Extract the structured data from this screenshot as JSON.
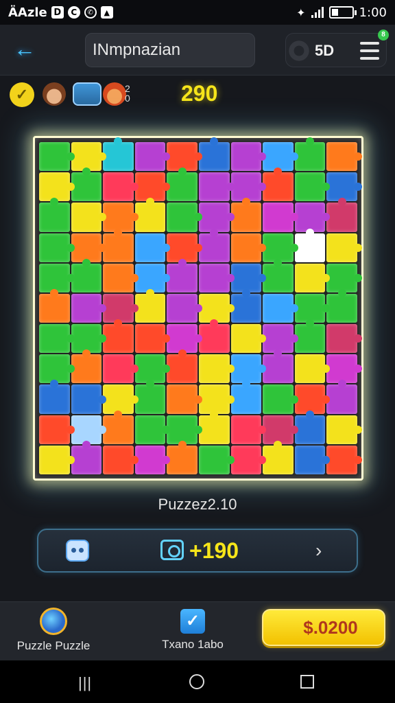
{
  "status_bar": {
    "left_text": "ÄAzle",
    "icons": [
      "notification-d-icon",
      "notification-c-icon",
      "wifi-calling-icon",
      "image-icon"
    ],
    "time": "1:00"
  },
  "header": {
    "title": "INmpnazian",
    "coins": "5D",
    "notification_count": "8"
  },
  "players": {
    "label_top": "2",
    "label_bottom": "0"
  },
  "score": "290",
  "board": {
    "columns": 10,
    "rows": 11,
    "pieces": [
      "#2fc43a",
      "#f3e21c",
      "#25c6d6",
      "#b640d2",
      "#ff4a2a",
      "#2a73d8",
      "#b640d2",
      "#3aa6ff",
      "#2fc43a",
      "#ff7a1c",
      "#f3e21c",
      "#2fc43a",
      "#ff3a5a",
      "#ff4a2a",
      "#2fc43a",
      "#b640d2",
      "#b640d2",
      "#ff4a2a",
      "#2fc43a",
      "#2a73d8",
      "#2fc43a",
      "#f3e21c",
      "#ff7a1c",
      "#f3e21c",
      "#2fc43a",
      "#b640d2",
      "#ff7a1c",
      "#d13ad0",
      "#b640d2",
      "#d13a6a",
      "#2fc43a",
      "#ff7a1c",
      "#ff7a1c",
      "#3aa6ff",
      "#ff4a2a",
      "#b640d2",
      "#ff7a1c",
      "#2fc43a",
      "#ffffff",
      "#f3e21c",
      "#2fc43a",
      "#2fc43a",
      "#ff7a1c",
      "#3aa6ff",
      "#b640d2",
      "#b640d2",
      "#2a73d8",
      "#2fc43a",
      "#f3e21c",
      "#2fc43a",
      "#ff7a1c",
      "#b640d2",
      "#d13a6a",
      "#f3e21c",
      "#b640d2",
      "#f3e21c",
      "#2a73d8",
      "#3aa6ff",
      "#2fc43a",
      "#2fc43a",
      "#2fc43a",
      "#2fc43a",
      "#ff4a2a",
      "#ff4a2a",
      "#d13ad0",
      "#ff3a5a",
      "#f3e21c",
      "#b640d2",
      "#2fc43a",
      "#d13a6a",
      "#2fc43a",
      "#ff7a1c",
      "#ff3a5a",
      "#2fc43a",
      "#ff4a2a",
      "#f3e21c",
      "#3aa6ff",
      "#b640d2",
      "#f3e21c",
      "#d13ad0",
      "#2a73d8",
      "#2a73d8",
      "#f3e21c",
      "#2fc43a",
      "#ff7a1c",
      "#f3e21c",
      "#3aa6ff",
      "#2fc43a",
      "#ff4a2a",
      "#b640d2",
      "#ff4a2a",
      "#a8d6ff",
      "#ff7a1c",
      "#2fc43a",
      "#2fc43a",
      "#f3e21c",
      "#ff3a5a",
      "#d13a6a",
      "#2a73d8",
      "#f3e21c",
      "#f3e21c",
      "#b640d2",
      "#ff4a2a",
      "#d13ad0",
      "#ff7a1c",
      "#2fc43a",
      "#ff3a5a",
      "#f3e21c",
      "#2a73d8",
      "#ff4a2a"
    ]
  },
  "puzzle_label": "Puzzez2.10",
  "reward": {
    "value": "+190"
  },
  "bottom_bar": {
    "left_label": "Puzzle Puzzle",
    "middle_label": "Txano 1abo",
    "buy_label": "$.0200"
  },
  "colors": {
    "score_yellow": "#f6e51a",
    "accent_blue": "#49c6ff",
    "buy_button": "#f2c100"
  }
}
